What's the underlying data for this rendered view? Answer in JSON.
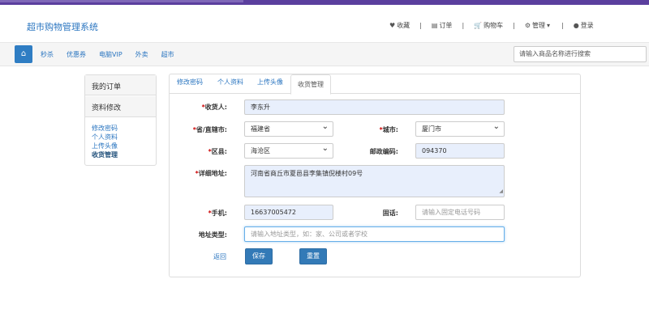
{
  "app": {
    "title": "超市购物管理系统"
  },
  "topnav": {
    "favorites": "收藏",
    "orders": "订单",
    "cart": "购物车",
    "manage": "管理",
    "login": "登录",
    "separator": "|"
  },
  "menu": {
    "items": [
      "秒杀",
      "优惠券",
      "电脑VIP",
      "外卖",
      "超市"
    ],
    "search_placeholder": "请输入商品名称进行搜索"
  },
  "sidebar": {
    "my_orders": "我的订单",
    "profile_edit": "资料修改",
    "links": [
      "修改密码",
      "个人资料",
      "上传头像",
      "收货管理"
    ]
  },
  "tabs": [
    "修改密码",
    "个人资料",
    "上传头像",
    "收货管理"
  ],
  "form": {
    "required_mark": "*",
    "receiver_label": "收货人:",
    "receiver_value": "李东升",
    "province_label": "省/直辖市:",
    "province_value": "福建省",
    "city_label": "城市:",
    "city_value": "厦门市",
    "district_label": "区县:",
    "district_value": "海沧区",
    "postcode_label": "邮政编码:",
    "postcode_value": "094370",
    "address_label": "详细地址:",
    "address_value": "河南省商丘市夏邑县李集镇倪楼村09号",
    "phone_label": "手机:",
    "phone_value": "16637005472",
    "landline_label": "固话:",
    "landline_placeholder": "请输入固定电话号码",
    "addrtype_label": "地址类型:",
    "addrtype_placeholder": "请输入地址类型，如：家、公司或者学校",
    "back_link": "返回",
    "save_button": "保存",
    "reset_button": "重置"
  },
  "colors": {
    "accent": "#337ab7",
    "link": "#2a75c0",
    "required": "#cc0000",
    "topbar": "#5b3f9e"
  }
}
